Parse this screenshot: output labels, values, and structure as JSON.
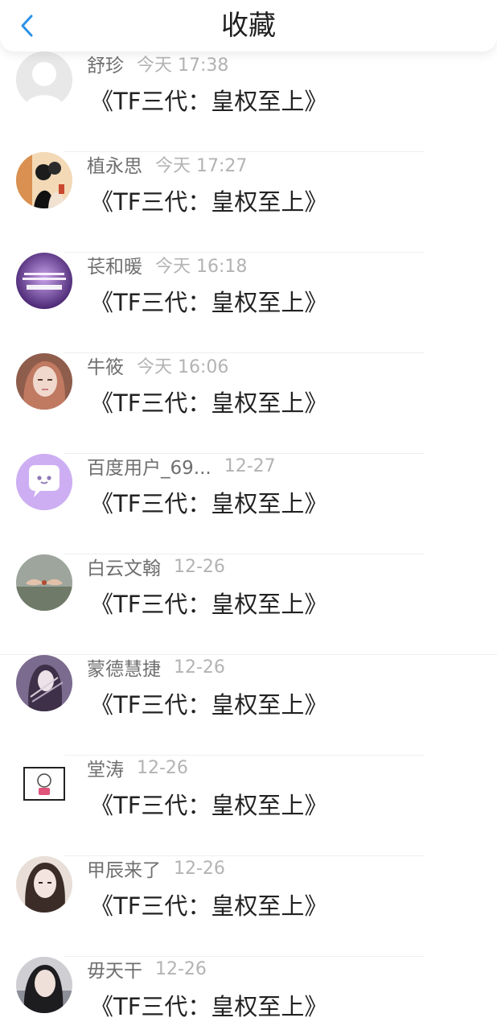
{
  "header": {
    "title": "收藏"
  },
  "items": [
    {
      "user": "舒珍",
      "time": "今天 17:38",
      "title": "《TF三代：皇权至上》",
      "avatar": "default-avatar-icon"
    },
    {
      "user": "植永思",
      "time": "今天 17:27",
      "title": "《TF三代：皇权至上》",
      "avatar": "couple-illustration-avatar"
    },
    {
      "user": "苌和暖",
      "time": "今天 16:18",
      "title": "《TF三代：皇权至上》",
      "avatar": "purple-text-avatar"
    },
    {
      "user": "牛筱",
      "time": "今天 16:06",
      "title": "《TF三代：皇权至上》",
      "avatar": "portrait-avatar"
    },
    {
      "user": "百度用户_69...",
      "time": "12-27",
      "title": "《TF三代：皇权至上》",
      "avatar": "purple-chat-bubble-avatar"
    },
    {
      "user": "白云文翰",
      "time": "12-26",
      "title": "《TF三代：皇权至上》",
      "avatar": "hands-avatar"
    },
    {
      "user": "蒙德慧捷",
      "time": "12-26",
      "title": "《TF三代：皇权至上》",
      "avatar": "anime-character-avatar"
    },
    {
      "user": "堂涛",
      "time": "12-26",
      "title": "《TF三代：皇权至上》",
      "avatar": "sketch-character-avatar"
    },
    {
      "user": "甲辰来了",
      "time": "12-26",
      "title": "《TF三代：皇权至上》",
      "avatar": "girl-portrait-avatar"
    },
    {
      "user": "毋天干",
      "time": "12-26",
      "title": "《TF三代：皇权至上》",
      "avatar": "girl-photo-avatar"
    }
  ],
  "colors": {
    "accent": "#2a91e8",
    "title_text": "#222222",
    "meta_text": "#6f6f6f",
    "time_text": "#b3b3b3"
  }
}
